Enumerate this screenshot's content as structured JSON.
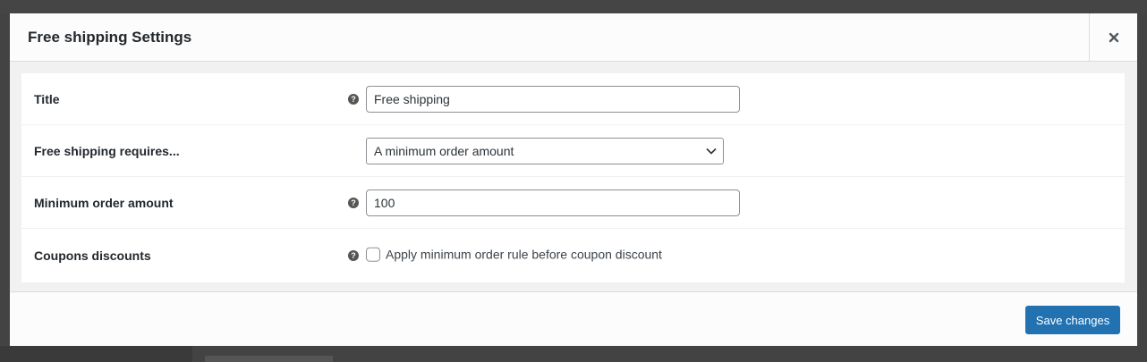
{
  "modal": {
    "title": "Free shipping Settings",
    "close_icon": "close-icon"
  },
  "form": {
    "rows": [
      {
        "label": "Title",
        "help_icon": "help-icon",
        "input_value": "Free shipping"
      },
      {
        "label": "Free shipping requires...",
        "select_value": "A minimum order amount",
        "select_icon": "chevron-down-icon"
      },
      {
        "label": "Minimum order amount",
        "help_icon": "help-icon",
        "input_value": "100"
      },
      {
        "label": "Coupons discounts",
        "help_icon": "help-icon",
        "checkbox_checked": false,
        "checkbox_label": "Apply minimum order rule before coupon discount"
      }
    ]
  },
  "footer": {
    "save_label": "Save changes"
  },
  "colors": {
    "primary_button": "#2271b1",
    "overlay": "#434343"
  }
}
